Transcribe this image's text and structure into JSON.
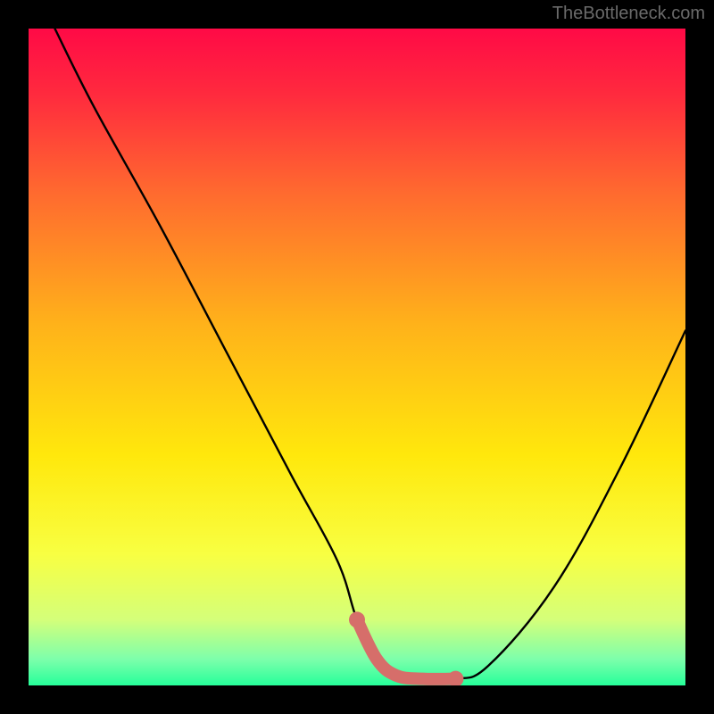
{
  "watermark": "TheBottleneck.com",
  "chart_data": {
    "type": "line",
    "title": "",
    "xlabel": "",
    "ylabel": "",
    "xlim": [
      0,
      100
    ],
    "ylim": [
      0,
      100
    ],
    "grid": false,
    "series": [
      {
        "name": "curve",
        "x": [
          4,
          10,
          20,
          30,
          40,
          47,
          50,
          53,
          56,
          60,
          65,
          70,
          80,
          90,
          100
        ],
        "y": [
          100,
          88,
          70,
          51,
          32,
          19,
          10,
          4,
          1.5,
          1,
          1,
          3,
          15,
          33,
          54
        ]
      }
    ],
    "highlight_segment": {
      "x": [
        50,
        53,
        56,
        60,
        65
      ],
      "y": [
        10,
        4,
        1.5,
        1,
        1
      ]
    },
    "background_gradient_stops": [
      {
        "offset": 0,
        "color": "#ff0a46"
      },
      {
        "offset": 10,
        "color": "#ff2a3e"
      },
      {
        "offset": 25,
        "color": "#ff6a2f"
      },
      {
        "offset": 45,
        "color": "#ffb21a"
      },
      {
        "offset": 65,
        "color": "#ffe80c"
      },
      {
        "offset": 80,
        "color": "#f8ff42"
      },
      {
        "offset": 90,
        "color": "#d4ff7a"
      },
      {
        "offset": 96,
        "color": "#7dffab"
      },
      {
        "offset": 100,
        "color": "#26ff9a"
      }
    ],
    "colors": {
      "curve": "#000000",
      "highlight": "#d66e6a"
    }
  }
}
